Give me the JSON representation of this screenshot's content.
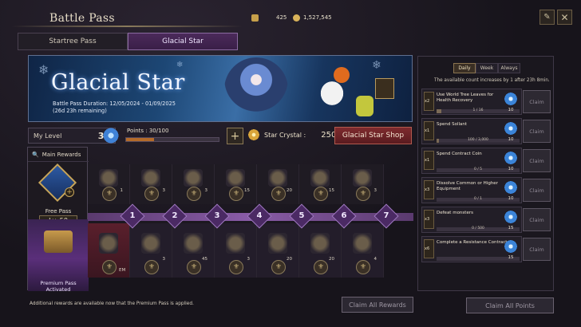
{
  "window": {
    "title": "Battle Pass"
  },
  "currencies": [
    {
      "icon": "arrow-currency-icon",
      "value": "425"
    },
    {
      "icon": "coin-icon",
      "value": "1,527,545"
    }
  ],
  "tabs": [
    {
      "label": "Startree Pass",
      "active": false
    },
    {
      "label": "Glacial Star",
      "active": true
    }
  ],
  "banner": {
    "title": "Glacial Star",
    "duration": "Battle Pass Duration: 12/05/2024 - 01/09/2025",
    "remaining": "(26d 23h remaining)"
  },
  "level": {
    "label": "My Level",
    "value": "34"
  },
  "points": {
    "text": "Points : 30/100",
    "fraction": 0.3
  },
  "star_crystal": {
    "label": "Star Crystal :",
    "value": "250"
  },
  "shop_button": "Glacial Star Shop",
  "left": {
    "main_rewards": "Main Rewards",
    "free_pass": "Free Pass",
    "free_level": "Lv. 50",
    "premium": "Premium Pass Activated"
  },
  "levels": [
    "1",
    "2",
    "3",
    "4",
    "5",
    "6",
    "7"
  ],
  "free_rewards": [
    "1",
    "3",
    "3",
    "15",
    "20",
    "15",
    "3"
  ],
  "premium_rewards": [
    "EM",
    "3",
    "45",
    "3",
    "20",
    "20",
    "4"
  ],
  "footnote": "Additional rewards are available now that the Premium Pass is applied.",
  "claim_all_rewards": "Claim All Rewards",
  "mission_tabs": [
    {
      "label": "Daily",
      "active": true
    },
    {
      "label": "Week",
      "active": false
    },
    {
      "label": "Always",
      "active": false
    }
  ],
  "mission_note": "The available count increases by 1 after 23h 8min.",
  "missions": [
    {
      "mult": "x2",
      "title": "Use World Tree Leaves for Health Recovery",
      "progress": "1 / 16",
      "fraction": 0.06,
      "reward": "10"
    },
    {
      "mult": "x1",
      "title": "Spend Sollant",
      "progress": "100 / 3,000",
      "fraction": 0.03,
      "reward": "10"
    },
    {
      "mult": "x1",
      "title": "Spend Contract Coin",
      "progress": "0 / 5",
      "fraction": 0,
      "reward": "10"
    },
    {
      "mult": "x3",
      "title": "Dissolve Common or Higher Equipment",
      "progress": "0 / 1",
      "fraction": 0,
      "reward": "10"
    },
    {
      "mult": "x3",
      "title": "Defeat monsters",
      "progress": "0 / 500",
      "fraction": 0,
      "reward": "15"
    },
    {
      "mult": "x6",
      "title": "Complete a Resistance Contract",
      "progress": "",
      "fraction": 0,
      "reward": "15"
    }
  ],
  "claim_label": "Claim",
  "claim_all_points": "Claim All Points"
}
